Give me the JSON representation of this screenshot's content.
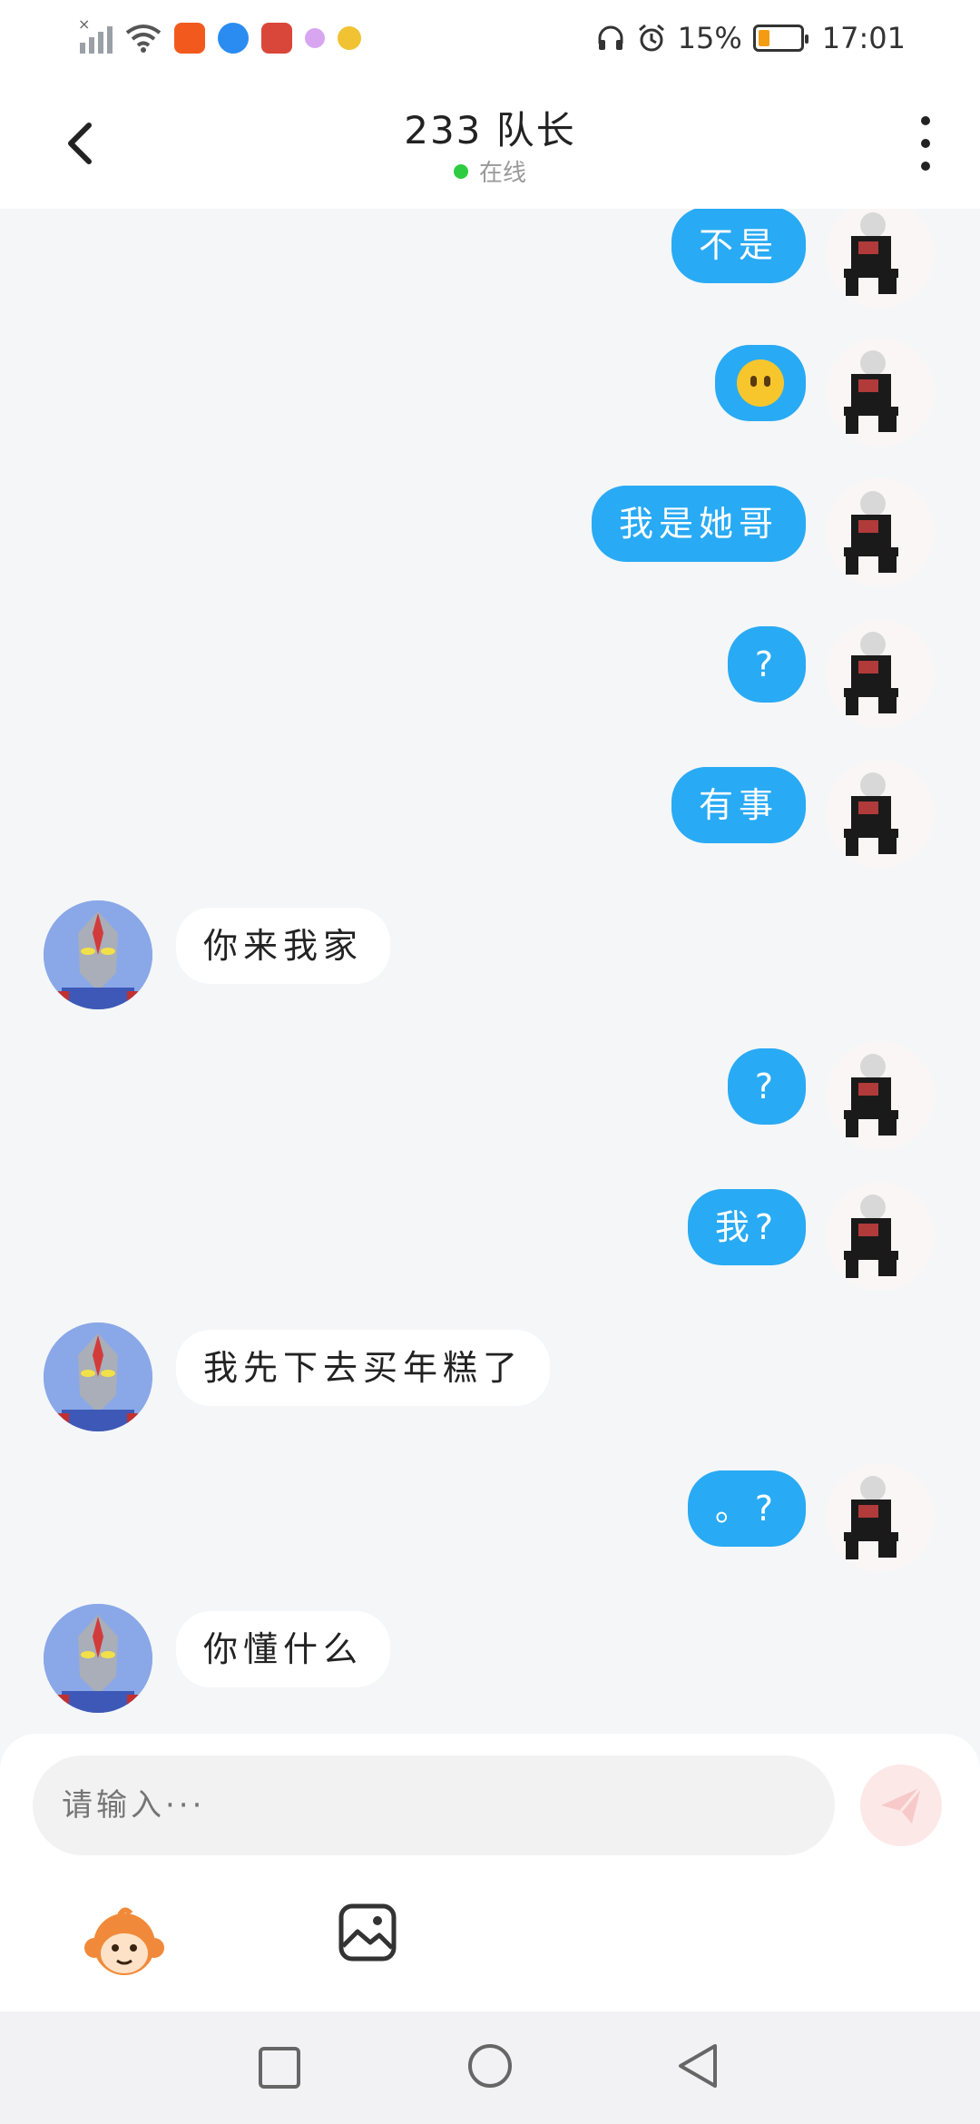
{
  "status_bar": {
    "battery_percent": "15%",
    "time": "17:01"
  },
  "header": {
    "title": "233 队长",
    "status": "在线"
  },
  "messages": [
    {
      "side": "out",
      "text": "不是"
    },
    {
      "side": "out",
      "text": "",
      "emoji": "expressionless-face"
    },
    {
      "side": "out",
      "text": "我是她哥"
    },
    {
      "side": "out",
      "text": "?"
    },
    {
      "side": "out",
      "text": "有事"
    },
    {
      "side": "in",
      "text": "你来我家"
    },
    {
      "side": "out",
      "text": "?"
    },
    {
      "side": "out",
      "text": "我?"
    },
    {
      "side": "in",
      "text": "我先下去买年糕了"
    },
    {
      "side": "out",
      "text": "。?"
    },
    {
      "side": "in",
      "text": "你懂什么"
    }
  ],
  "composer": {
    "placeholder": "请输入···"
  },
  "colors": {
    "outgoing_bubble": "#29aaf4",
    "incoming_bubble": "#ffffff",
    "background": "#f4f6f8",
    "online_dot": "#2ecc40"
  }
}
